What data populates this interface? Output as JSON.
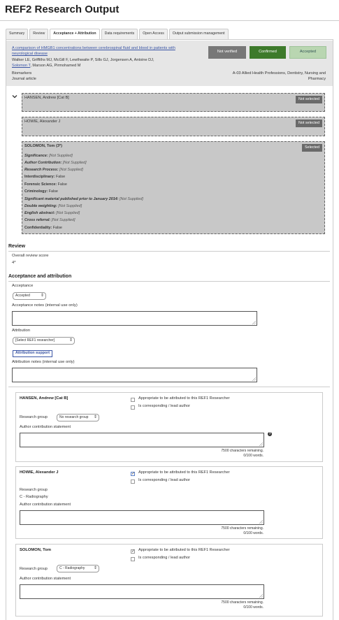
{
  "page": {
    "title": "REF2 Research Output"
  },
  "tabs": [
    {
      "label": "Summary"
    },
    {
      "label": "Review"
    },
    {
      "label": "Acceptance + Attribution"
    },
    {
      "label": "Data requirements"
    },
    {
      "label": "Open Access"
    },
    {
      "label": "Output submission management"
    }
  ],
  "output": {
    "title": "A comparison of HMGB1 concentrations between cerebrospinal fluid and blood in patients with neurological disease",
    "authors_line1": "Walker LE, Griffiths MJ, McGill F, Lewthwaite P, Sills GJ, Jorgensen A, Antoine DJ,",
    "authors_link": "Solomon T",
    "authors_line2_rest": ", Marson AG, Pirmohamed M",
    "subject": "Biomarkers",
    "type": "Journal article",
    "uoa_line1": "A-03 Allied Health Professions, Dentistry, Nursing and",
    "uoa_line2": "Pharmacy",
    "status_not_verified": "Not verified",
    "status_confirmed": "Confirmed",
    "status_accepted": "Accepted"
  },
  "researchers": [
    {
      "name": "HANSEN, Andrew [Cat B]",
      "badge": "Not selected"
    },
    {
      "name": "HOWIE, Alexander J",
      "badge": "Not selected"
    },
    {
      "name": "SOLOMON, Tom (3*)",
      "badge": "Selected",
      "flags": [
        {
          "label": "Significance:",
          "value": "[Not Supplied]"
        },
        {
          "label": "Author Contribution:",
          "value": "[Not Supplied]"
        },
        {
          "label": "Research Process:",
          "value": "[Not Supplied]"
        },
        {
          "label": "Interdisciplinary:",
          "value": "False"
        },
        {
          "label": "Forensic Science:",
          "value": "False"
        },
        {
          "label": "Criminology:",
          "value": "False"
        },
        {
          "label": "Significant material published prior to January 2014:",
          "value": "[Not Supplied]"
        },
        {
          "label": "Double weighting:",
          "value": "[Not Supplied]"
        },
        {
          "label": "English abstract:",
          "value": "[Not Supplied]"
        },
        {
          "label": "Cross referral:",
          "value": "[Not Supplied]"
        },
        {
          "label": "Confidentiality:",
          "value": "False"
        }
      ]
    }
  ],
  "review": {
    "heading": "Review",
    "score_label": "Overall review score",
    "score_value": "4*"
  },
  "acceptance": {
    "heading": "Acceptance and attribution",
    "acceptance_label": "Acceptance",
    "acceptance_value": "Accepted",
    "acceptance_notes_label": "Acceptance notes (internal use only)",
    "attribution_label": "Attribution",
    "attribution_value": "[Select REF1 researcher]",
    "attribution_support_button": "Attribution support",
    "attribution_notes_label": "Attribution notes (internal use only)"
  },
  "attribution_boxes": [
    {
      "name": "HANSEN, Andrew [Cat B]",
      "appropriate_checked": false,
      "corresponding_checked": false,
      "research_group_label": "Research group",
      "research_group_value": "No research group",
      "contribution_label": "Author contribution statement",
      "remaining_chars": "7500 characters remaining.",
      "remaining_words": "0/100 words."
    },
    {
      "name": "HOWIE, Alexander J",
      "appropriate_checked": true,
      "corresponding_checked": false,
      "research_group_label": "Research group",
      "research_group_value": "C - Radiography",
      "contribution_label": "Author contribution statement",
      "remaining_chars": "7500 characters remaining.",
      "remaining_words": "0/100 words."
    },
    {
      "name": "SOLOMON, Tom",
      "appropriate_checked": true,
      "corresponding_checked": false,
      "research_group_label": "Research group",
      "research_group_value": "C - Radiography",
      "contribution_label": "Author contribution statement",
      "remaining_chars": "7500 characters remaining.",
      "remaining_words": "0/100 words."
    }
  ],
  "attribution_box_labels": {
    "appropriate": "Appropriate to be attributed to this REF1 Researcher",
    "corresponding": "Is corresponding / lead author"
  },
  "icons": {
    "help": "help-icon",
    "collapse": "chevron-down-icon"
  },
  "colors": {
    "link": "#3a55a5",
    "confirmed": "#3d7a2b",
    "accepted": "#b9d6b1",
    "not_verified": "#777777"
  }
}
